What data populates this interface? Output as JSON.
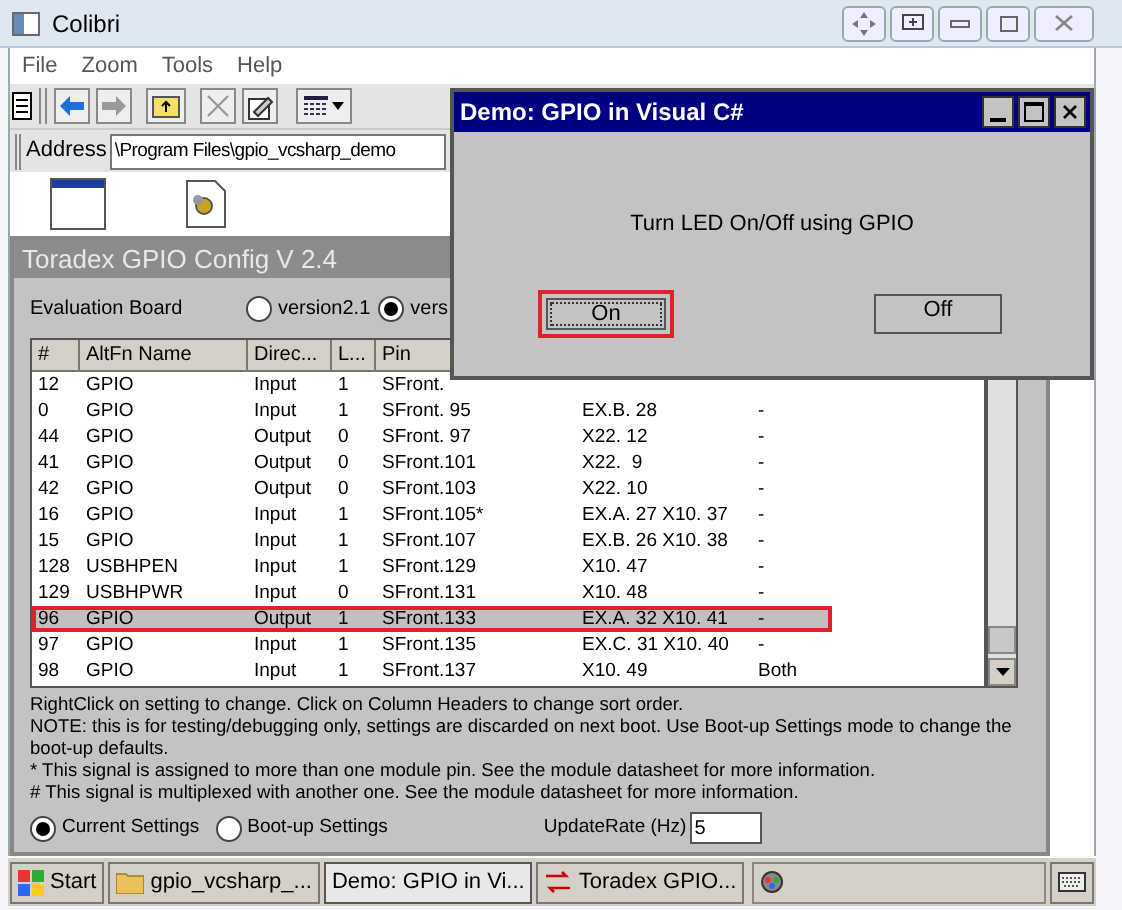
{
  "window": {
    "title": "Colibri",
    "menu": [
      "File",
      "Zoom",
      "Tools",
      "Help"
    ]
  },
  "address_bar": {
    "label": "Address",
    "value": "\\Program Files\\gpio_vcsharp_demo"
  },
  "gpio_window": {
    "title": "Toradex GPIO Config V 2.4",
    "board_label": "Evaluation Board",
    "board_options": [
      {
        "label": "version2.1",
        "selected": false
      },
      {
        "label": "vers",
        "selected": true
      }
    ],
    "table": {
      "columns": [
        "#",
        "AltFn Name",
        "Direc...",
        "L...",
        "Pin"
      ],
      "rows": [
        {
          "cells": [
            "12",
            "GPIO",
            "Input",
            "1",
            "SFront."
          ],
          "selected": false
        },
        {
          "cells": [
            "0",
            "GPIO",
            "Input",
            "1",
            "SFront. 95",
            "EX.B. 28",
            "-"
          ],
          "selected": false
        },
        {
          "cells": [
            "44",
            "GPIO",
            "Output",
            "0",
            "SFront. 97",
            "X22. 12",
            "-"
          ],
          "selected": false
        },
        {
          "cells": [
            "41",
            "GPIO",
            "Output",
            "0",
            "SFront.101",
            "X22.  9",
            "-"
          ],
          "selected": false
        },
        {
          "cells": [
            "42",
            "GPIO",
            "Output",
            "0",
            "SFront.103",
            "X22. 10",
            "-"
          ],
          "selected": false
        },
        {
          "cells": [
            "16",
            "GPIO",
            "Input",
            "1",
            "SFront.105*",
            "EX.A. 27 X10. 37",
            "-"
          ],
          "selected": false
        },
        {
          "cells": [
            "15",
            "GPIO",
            "Input",
            "1",
            "SFront.107",
            "EX.B. 26 X10. 38",
            "-"
          ],
          "selected": false
        },
        {
          "cells": [
            "128",
            "USBHPEN",
            "Input",
            "1",
            "SFront.129",
            "X10. 47",
            "-"
          ],
          "selected": false
        },
        {
          "cells": [
            "129",
            "USBHPWR",
            "Input",
            "0",
            "SFront.131",
            "X10. 48",
            "-"
          ],
          "selected": false
        },
        {
          "cells": [
            "96",
            "GPIO",
            "Output",
            "1",
            "SFront.133",
            "EX.A. 32 X10. 41",
            "-"
          ],
          "selected": true
        },
        {
          "cells": [
            "97",
            "GPIO",
            "Input",
            "1",
            "SFront.135",
            "EX.C. 31 X10. 40",
            "-"
          ],
          "selected": false
        },
        {
          "cells": [
            "98",
            "GPIO",
            "Input",
            "1",
            "SFront.137",
            "X10. 49",
            "Both"
          ],
          "selected": false
        }
      ]
    },
    "notes": [
      "RightClick on setting to change. Click on Column Headers to change sort order.",
      "NOTE: this is for testing/debugging only, settings are discarded on next boot. Use Boot-up Settings mode to change the boot-up defaults.",
      "* This signal is assigned to more than one module pin. See the module datasheet for more information.",
      "# This signal is multiplexed with another one. See the module datasheet for more information."
    ],
    "modes": [
      {
        "label": "Current Settings",
        "selected": true
      },
      {
        "label": "Boot-up Settings",
        "selected": false
      }
    ],
    "update_rate": {
      "label": "UpdateRate (Hz)",
      "value": "5"
    }
  },
  "dialog": {
    "title": "Demo: GPIO in Visual C#",
    "message": "Turn LED On/Off using GPIO",
    "buttons": [
      {
        "label": "On",
        "selected": true
      },
      {
        "label": "Off",
        "selected": false
      }
    ]
  },
  "taskbar": {
    "start": "Start",
    "tasks": [
      {
        "label": "gpio_vcsharp_...",
        "kind": "folder",
        "selected": false
      },
      {
        "label": "Demo: GPIO in Vi...",
        "kind": "app",
        "selected": true
      },
      {
        "label": "Toradex GPIO...",
        "kind": "gpio",
        "selected": false
      }
    ]
  }
}
